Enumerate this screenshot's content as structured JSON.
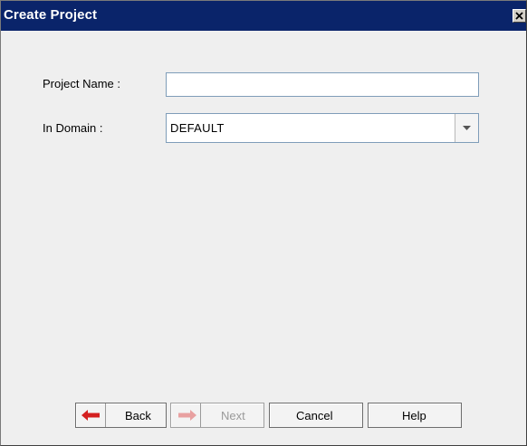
{
  "window": {
    "title": "Create Project"
  },
  "form": {
    "project_name_label": "Project Name :",
    "project_name_value": "",
    "domain_label": "In Domain :",
    "domain_selected": "DEFAULT"
  },
  "buttons": {
    "back": "Back",
    "next": "Next",
    "cancel": "Cancel",
    "help": "Help"
  },
  "icons": {
    "close": "close-icon",
    "dropdown": "chevron-down-icon",
    "back": "arrow-left-icon",
    "next": "arrow-right-icon"
  },
  "colors": {
    "titlebar": "#0a246a",
    "back_arrow": "#d42020",
    "next_arrow_disabled": "#e8a0a0"
  }
}
